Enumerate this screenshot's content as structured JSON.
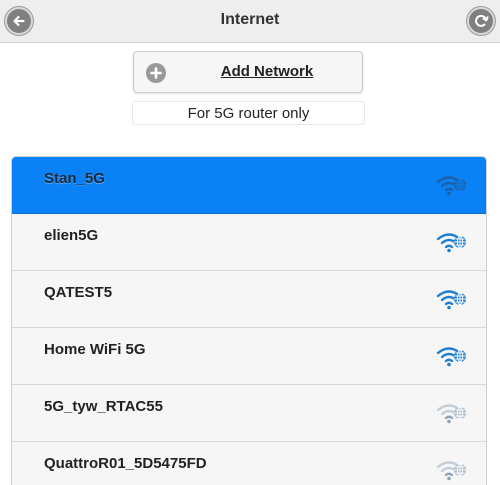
{
  "header": {
    "title": "Internet",
    "back_icon": "back-arrow-icon",
    "refresh_icon": "refresh-icon"
  },
  "add_network": {
    "label": "Add Network",
    "icon": "plus-circle-icon"
  },
  "note": "For 5G router only",
  "networks": [
    {
      "name": "Stan_5G",
      "selected": true,
      "signal_icon": "wifi-globe-icon"
    },
    {
      "name": "elien5G",
      "selected": false,
      "signal_icon": "wifi-globe-icon"
    },
    {
      "name": "QATEST5",
      "selected": false,
      "signal_icon": "wifi-globe-icon"
    },
    {
      "name": "Home WiFi 5G",
      "selected": false,
      "signal_icon": "wifi-globe-icon"
    },
    {
      "name": "5G_tyw_RTAC55",
      "selected": false,
      "signal_icon": "wifi-globe-icon"
    },
    {
      "name": "QuattroR01_5D5475FD",
      "selected": false,
      "signal_icon": "wifi-globe-icon"
    }
  ],
  "colors": {
    "selected_row": "#0a82f5",
    "row_background": "#f6f6f6",
    "wifi_strong": "#1f7fcf",
    "wifi_weak": "#b9c6d2"
  }
}
